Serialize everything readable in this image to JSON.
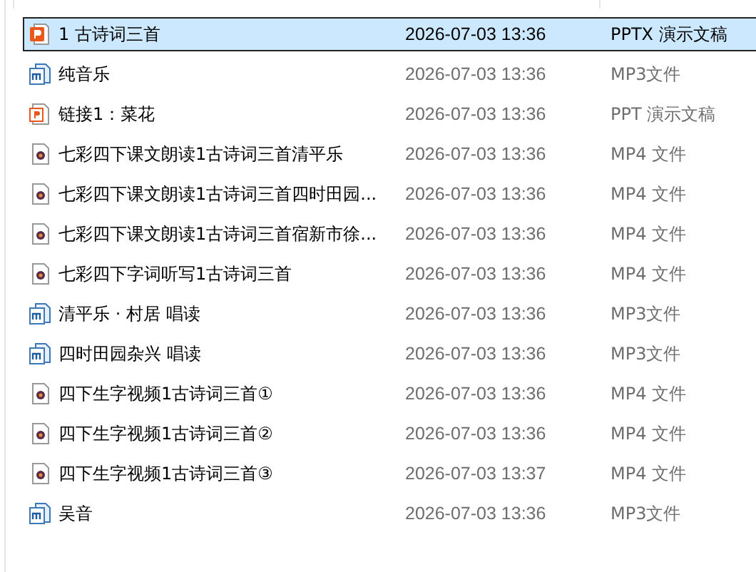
{
  "files": [
    {
      "name": "1 古诗词三首",
      "date": "2026-07-03 13:36",
      "type": "PPTX 演示文稿",
      "kind": "pptx",
      "selected": true
    },
    {
      "name": "纯音乐",
      "date": "2026-07-03 13:36",
      "type": "MP3文件",
      "kind": "mp3",
      "selected": false
    },
    {
      "name": "链接1：菜花",
      "date": "2026-07-03 13:36",
      "type": "PPT 演示文稿",
      "kind": "ppt",
      "selected": false
    },
    {
      "name": "七彩四下课文朗读1古诗词三首清平乐",
      "date": "2026-07-03 13:36",
      "type": "MP4 文件",
      "kind": "mp4",
      "selected": false
    },
    {
      "name": "七彩四下课文朗读1古诗词三首四时田园...",
      "date": "2026-07-03 13:36",
      "type": "MP4 文件",
      "kind": "mp4",
      "selected": false
    },
    {
      "name": "七彩四下课文朗读1古诗词三首宿新市徐...",
      "date": "2026-07-03 13:36",
      "type": "MP4 文件",
      "kind": "mp4",
      "selected": false
    },
    {
      "name": "七彩四下字词听写1古诗词三首",
      "date": "2026-07-03 13:36",
      "type": "MP4 文件",
      "kind": "mp4",
      "selected": false
    },
    {
      "name": "清平乐 · 村居 唱读",
      "date": "2026-07-03 13:36",
      "type": "MP3文件",
      "kind": "mp3",
      "selected": false
    },
    {
      "name": "四时田园杂兴 唱读",
      "date": "2026-07-03 13:36",
      "type": "MP3文件",
      "kind": "mp3",
      "selected": false
    },
    {
      "name": "四下生字视频1古诗词三首①",
      "date": "2026-07-03 13:36",
      "type": "MP4 文件",
      "kind": "mp4",
      "selected": false
    },
    {
      "name": "四下生字视频1古诗词三首②",
      "date": "2026-07-03 13:36",
      "type": "MP4 文件",
      "kind": "mp4",
      "selected": false
    },
    {
      "name": "四下生字视频1古诗词三首③",
      "date": "2026-07-03 13:37",
      "type": "MP4 文件",
      "kind": "mp4",
      "selected": false
    },
    {
      "name": "吴音",
      "date": "2026-07-03 13:36",
      "type": "MP3文件",
      "kind": "mp3",
      "selected": false
    }
  ]
}
